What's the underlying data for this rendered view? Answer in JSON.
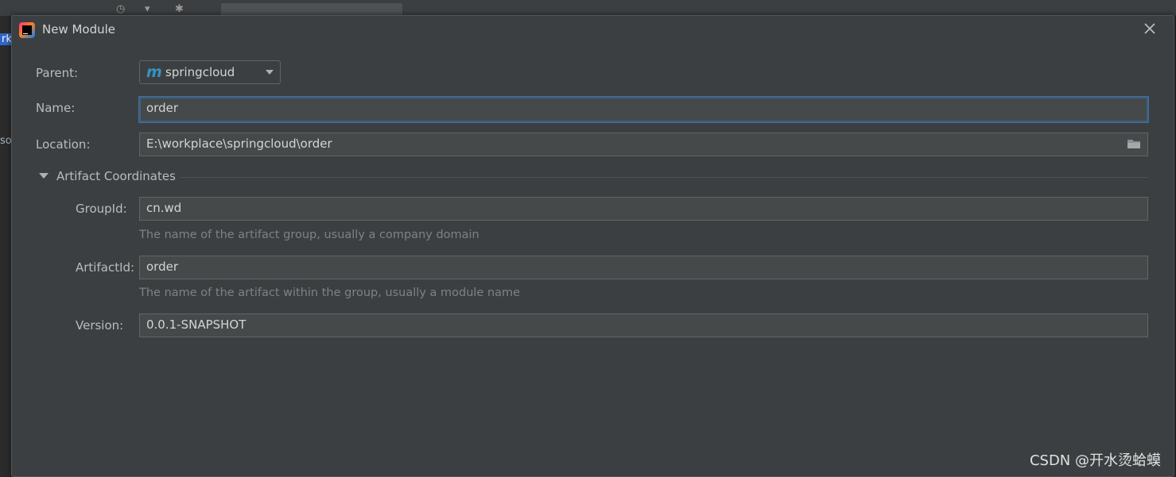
{
  "dialog": {
    "title": "New Module",
    "close_icon": "close-icon"
  },
  "parent": {
    "label": "Parent:",
    "icon": "m",
    "value": "springcloud"
  },
  "name": {
    "label": "Name:",
    "value": "order"
  },
  "location": {
    "label": "Location:",
    "value": "E:\\workplace\\springcloud\\order",
    "browse_icon": "folder-icon"
  },
  "artifact_section": {
    "title": "Artifact Coordinates",
    "expanded": true
  },
  "group_id": {
    "label": "GroupId:",
    "value": "cn.wd",
    "hint": "The name of the artifact group, usually a company domain"
  },
  "artifact_id": {
    "label": "ArtifactId:",
    "value": "order",
    "hint": "The name of the artifact within the group, usually a module name"
  },
  "version": {
    "label": "Version:",
    "value": "0.0.1-SNAPSHOT"
  },
  "watermark": "CSDN @开水烫蛤蟆",
  "colors": {
    "dialog_bg": "#3c3f41",
    "field_bg": "#45494a",
    "focus_border": "#3d6185",
    "maven_blue": "#3592c4"
  }
}
